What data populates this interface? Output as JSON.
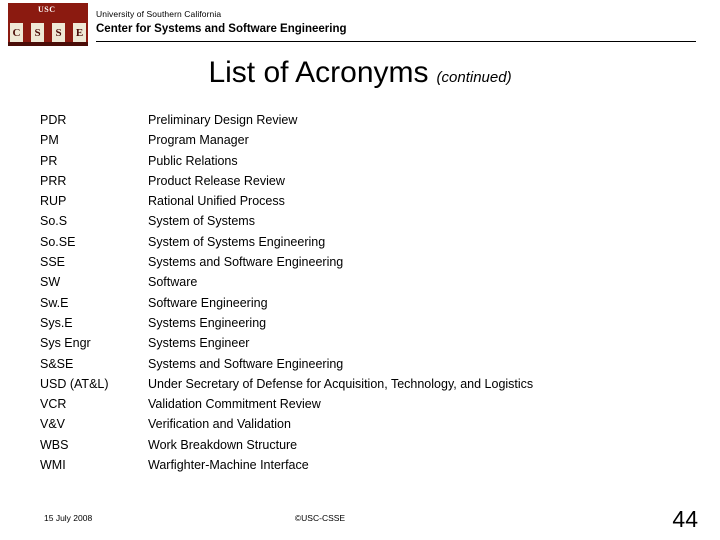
{
  "header": {
    "logo": {
      "usc_text": "USC",
      "columns": [
        "C",
        "S",
        "S",
        "E"
      ]
    },
    "org_line1": "University of Southern California",
    "org_line2": "Center for Systems and Software Engineering"
  },
  "title": {
    "main": "List of Acronyms",
    "continued": "(continued)"
  },
  "acronyms": [
    {
      "abbr": "PDR",
      "expansion": "Preliminary Design Review"
    },
    {
      "abbr": "PM",
      "expansion": "Program Manager"
    },
    {
      "abbr": "PR",
      "expansion": "Public Relations"
    },
    {
      "abbr": "PRR",
      "expansion": "Product Release Review"
    },
    {
      "abbr": "RUP",
      "expansion": "Rational Unified Process"
    },
    {
      "abbr": "So.S",
      "expansion": "System of Systems"
    },
    {
      "abbr": "So.SE",
      "expansion": "System of Systems Engineering"
    },
    {
      "abbr": "SSE",
      "expansion": "Systems and Software Engineering"
    },
    {
      "abbr": "SW",
      "expansion": "Software"
    },
    {
      "abbr": "Sw.E",
      "expansion": "Software Engineering"
    },
    {
      "abbr": "Sys.E",
      "expansion": "Systems Engineering"
    },
    {
      "abbr": "Sys Engr",
      "expansion": "Systems Engineer"
    },
    {
      "abbr": "S&SE",
      "expansion": "Systems and Software Engineering"
    },
    {
      "abbr": "USD (AT&L)",
      "expansion": "Under Secretary of Defense for Acquisition, Technology, and Logistics"
    },
    {
      "abbr": "VCR",
      "expansion": "Validation Commitment Review"
    },
    {
      "abbr": "V&V",
      "expansion": "Verification and Validation"
    },
    {
      "abbr": "WBS",
      "expansion": "Work Breakdown Structure"
    },
    {
      "abbr": "WMI",
      "expansion": "Warfighter-Machine Interface"
    }
  ],
  "footer": {
    "date": "15 July 2008",
    "copyright": "©USC-CSSE",
    "page_number": "44"
  }
}
